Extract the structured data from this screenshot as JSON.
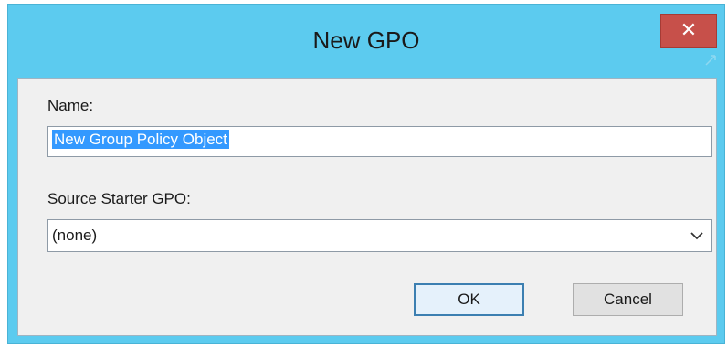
{
  "dialog": {
    "title": "New GPO",
    "close_icon": "close-icon",
    "close_glyph": "✕"
  },
  "fields": {
    "name": {
      "label": "Name:",
      "value": "New Group Policy Object",
      "selected": true
    },
    "source_starter": {
      "label": "Source Starter GPO:",
      "selected_value": "(none)",
      "icon": "chevron-down-icon"
    }
  },
  "buttons": {
    "ok_label": "OK",
    "cancel_label": "Cancel"
  },
  "colors": {
    "titlebar": "#5ccbef",
    "close_button": "#c7504a",
    "selection": "#3399ff",
    "client_background": "#f0f0f0"
  }
}
